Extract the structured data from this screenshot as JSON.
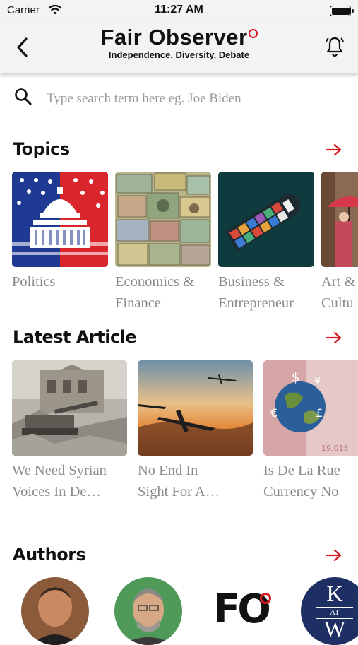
{
  "status": {
    "carrier": "Carrier",
    "time": "11:27 AM"
  },
  "header": {
    "title": "Fair Observer",
    "subtitle": "Independence, Diversity, Debate"
  },
  "search": {
    "placeholder": "Type search term here eg. Joe Biden"
  },
  "topics": {
    "title": "Topics",
    "items": [
      {
        "label_line1": "Politics",
        "label_line2": ""
      },
      {
        "label_line1": "Economics &",
        "label_line2": "Finance"
      },
      {
        "label_line1": "Business &",
        "label_line2": "Entrepreneur"
      },
      {
        "label_line1": "Art &",
        "label_line2": "Cultu"
      }
    ]
  },
  "latest": {
    "title": "Latest Article",
    "items": [
      {
        "line1": "We Need Syrian",
        "line2": "Voices In De…"
      },
      {
        "line1": "No End In",
        "line2": "Sight For A…"
      },
      {
        "line1": "Is De La Rue",
        "line2": "Currency No"
      }
    ]
  },
  "authors": {
    "title": "Authors",
    "logo_text": "FO",
    "kw_top": "K",
    "kw_mid": "AT",
    "kw_bottom": "W"
  },
  "colors": {
    "accent": "#d71920",
    "navbar_bg": "#f3f3f3",
    "label_gray": "#8a8a8a"
  }
}
